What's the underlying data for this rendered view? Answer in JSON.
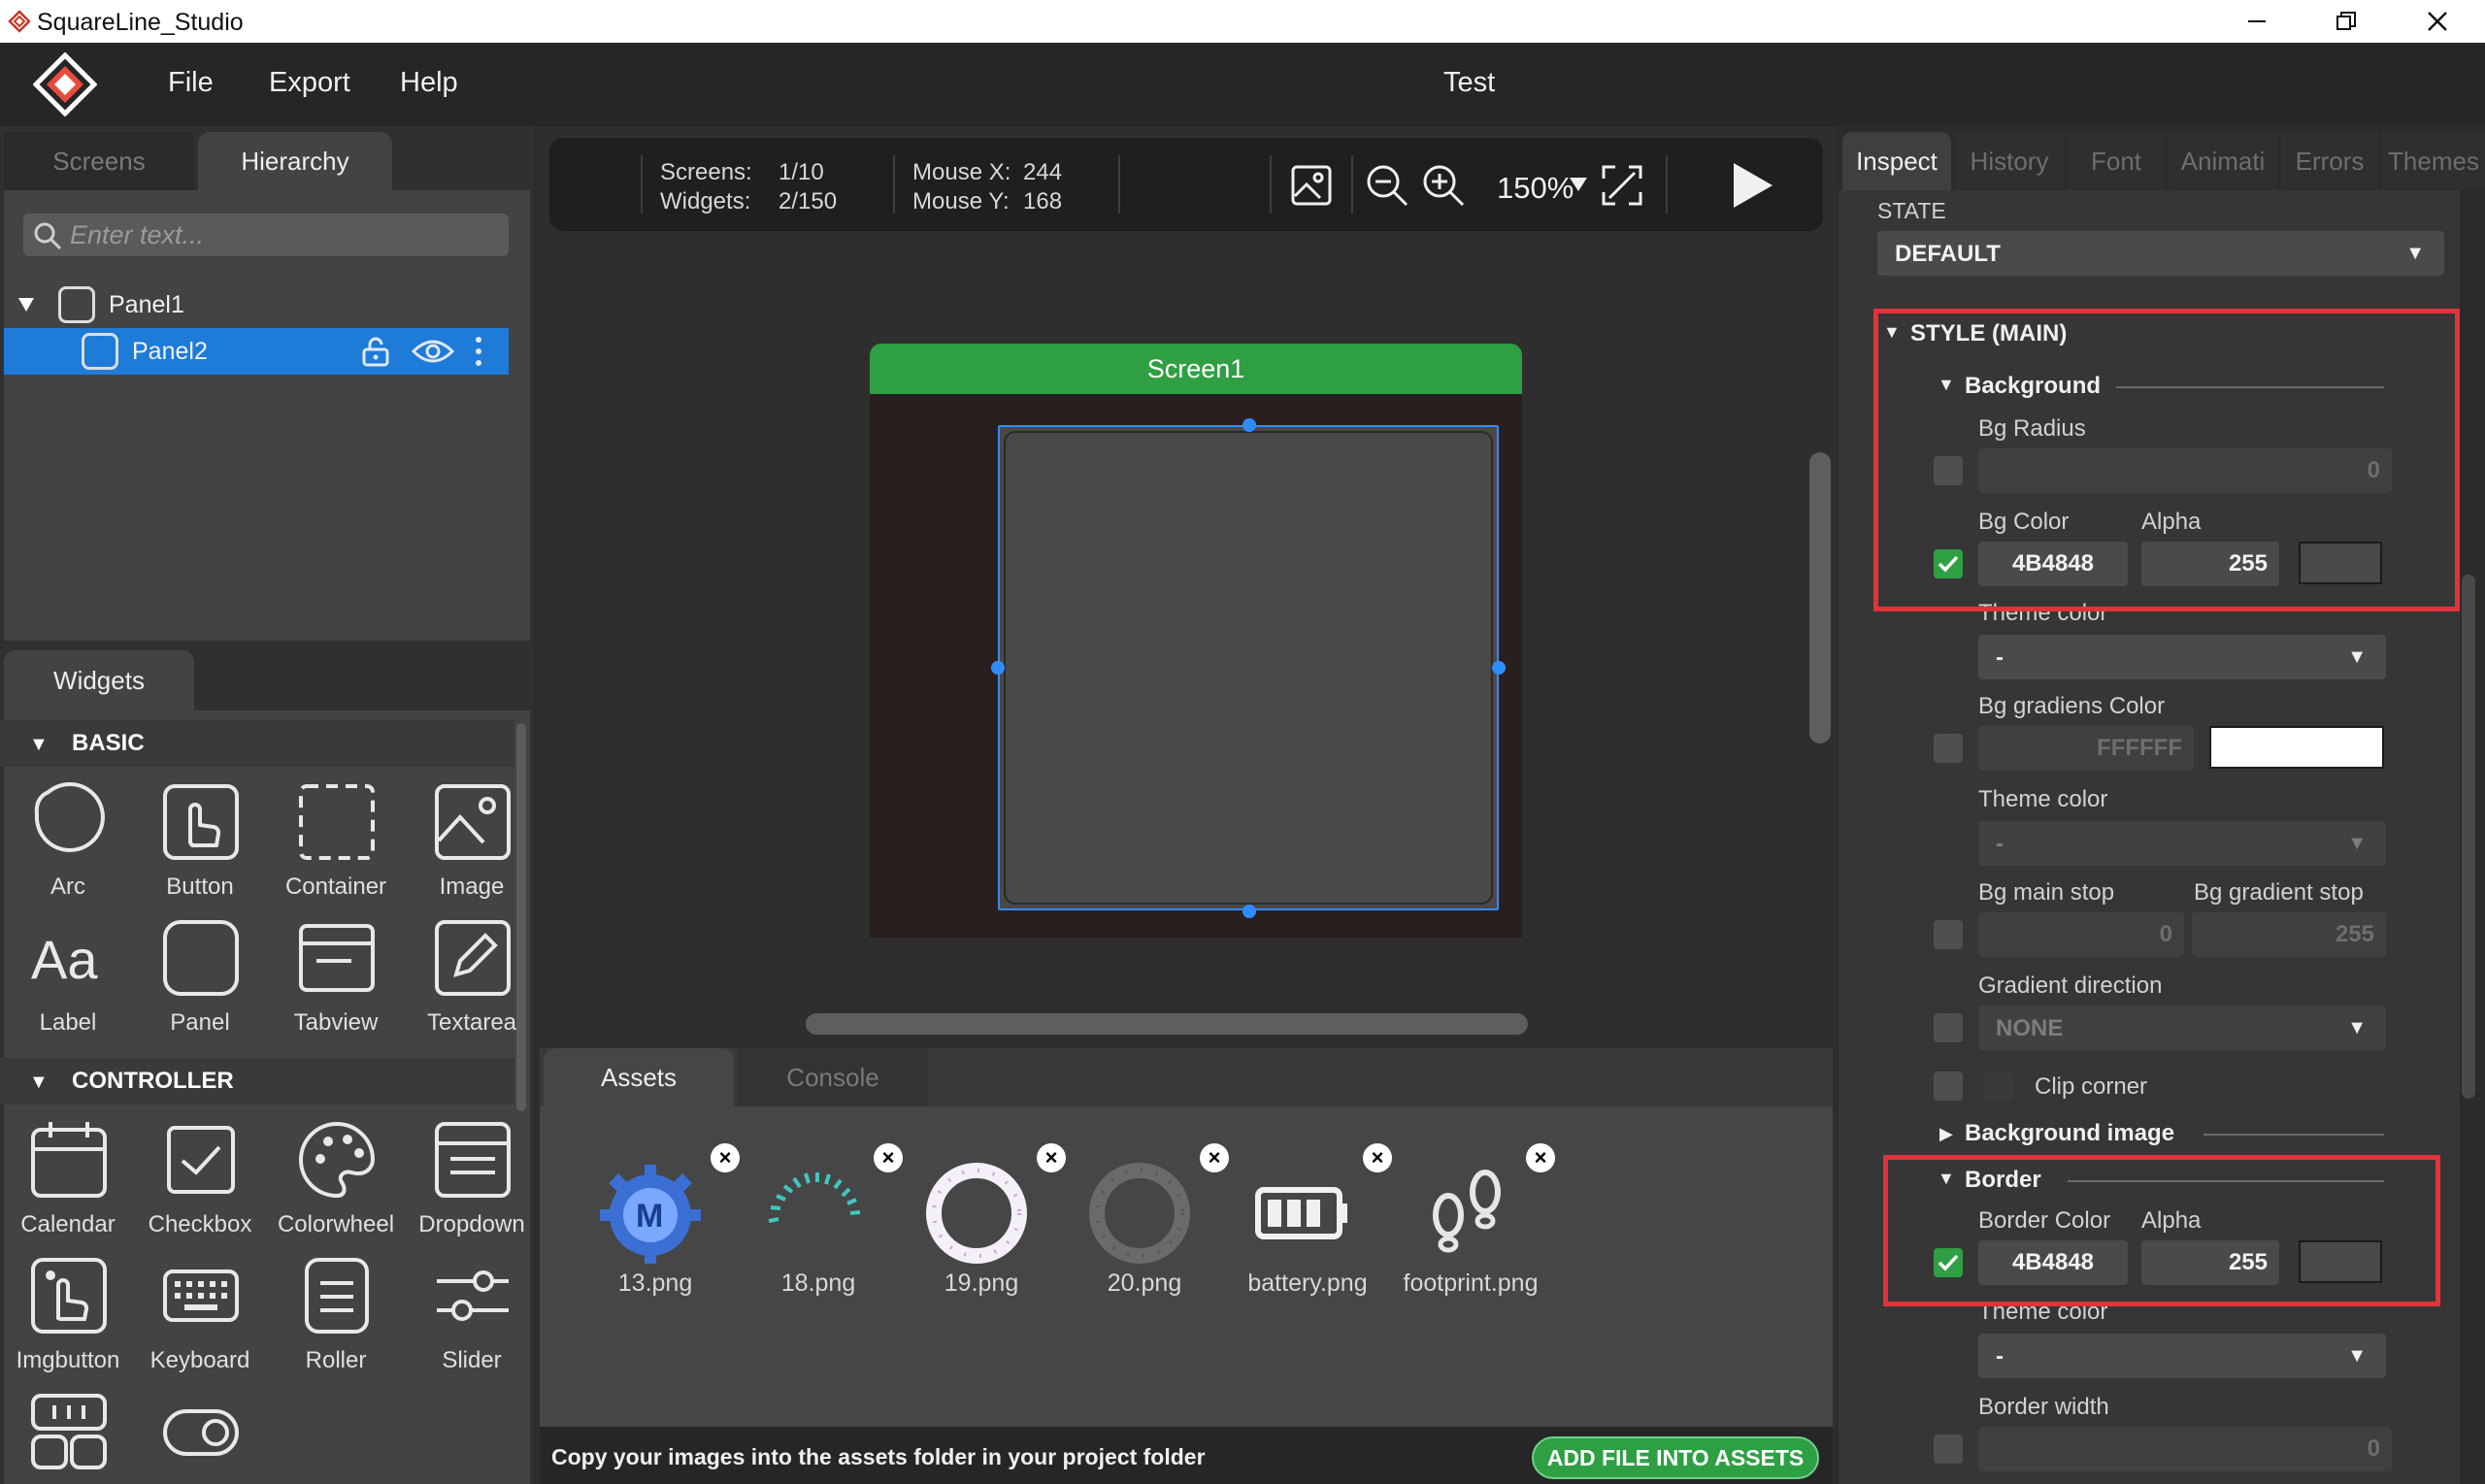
{
  "window": {
    "title": "SquareLine_Studio",
    "controls": [
      "minimize-icon",
      "restore-icon",
      "close-icon"
    ]
  },
  "menu": {
    "items": [
      "File",
      "Export",
      "Help"
    ],
    "project_title": "Test"
  },
  "left_panel": {
    "tabs": [
      "Screens",
      "Hierarchy"
    ],
    "active_tab": "Hierarchy",
    "search_placeholder": "Enter text...",
    "tree": [
      {
        "label": "Panel1",
        "expanded": true
      },
      {
        "label": "Panel2",
        "selected": true
      }
    ]
  },
  "widgets_panel": {
    "tab": "Widgets",
    "sections": [
      {
        "title": "BASIC",
        "items": [
          "Arc",
          "Button",
          "Container",
          "Image",
          "Label",
          "Panel",
          "Tabview",
          "Textarea"
        ]
      },
      {
        "title": "CONTROLLER",
        "items": [
          "Calendar",
          "Checkbox",
          "Colorwheel",
          "Dropdown",
          "Imgbutton",
          "Keyboard",
          "Roller",
          "Slider"
        ]
      }
    ]
  },
  "toolbar": {
    "screens_label": "Screens:",
    "screens_value": "1/10",
    "widgets_label": "Widgets:",
    "widgets_value": "2/150",
    "mouse_x_label": "Mouse X:",
    "mouse_x_value": "244",
    "mouse_y_label": "Mouse Y:",
    "mouse_y_value": "168",
    "zoom": "150%"
  },
  "canvas": {
    "screen_name": "Screen1",
    "screen_bg": "#2a1f1f",
    "panel_color": "#4b4848",
    "header_color": "#2ea043"
  },
  "assets_panel": {
    "tabs": [
      "Assets",
      "Console"
    ],
    "active_tab": "Assets",
    "files": [
      "13.png",
      "18.png",
      "19.png",
      "20.png",
      "battery.png",
      "footprint.png"
    ],
    "footer_text": "Copy your images into the assets folder in your project folder",
    "add_button": "ADD FILE INTO ASSETS"
  },
  "inspector": {
    "tabs": [
      "Inspect",
      "History",
      "Font",
      "Animati",
      "Errors",
      "Themes"
    ],
    "active_tab": "Inspect",
    "state_label": "STATE",
    "state_value": "DEFAULT",
    "style_section": "STYLE (MAIN)",
    "background": {
      "header": "Background",
      "bg_radius_label": "Bg Radius",
      "bg_radius_value": "0",
      "bg_color_label": "Bg Color",
      "alpha_label": "Alpha",
      "bg_color_value": "4B4848",
      "bg_alpha_value": "255",
      "theme_color_label": "Theme color",
      "theme_color_value": "-",
      "bg_gradient_label": "Bg gradiens Color",
      "bg_gradient_value": "FFFFFF",
      "theme_color_label_2": "Theme color",
      "theme_color_value_2": "-",
      "bg_main_stop_label": "Bg main stop",
      "bg_main_stop_value": "0",
      "bg_gradient_stop_label": "Bg gradient stop",
      "bg_gradient_stop_value": "255",
      "gradient_direction_label": "Gradient direction",
      "gradient_direction_value": "NONE",
      "clip_corner_label": "Clip corner"
    },
    "background_image_header": "Background image",
    "border": {
      "header": "Border",
      "border_color_label": "Border Color",
      "alpha_label": "Alpha",
      "border_color_value": "4B4848",
      "border_alpha_value": "255",
      "theme_color_label": "Theme color",
      "theme_color_value": "-",
      "border_width_label": "Border width",
      "border_width_value": "0"
    },
    "colors": {
      "accent_green": "#2ea043",
      "highlight_red": "#e0343a",
      "selection_blue": "#1e7bd8"
    }
  }
}
